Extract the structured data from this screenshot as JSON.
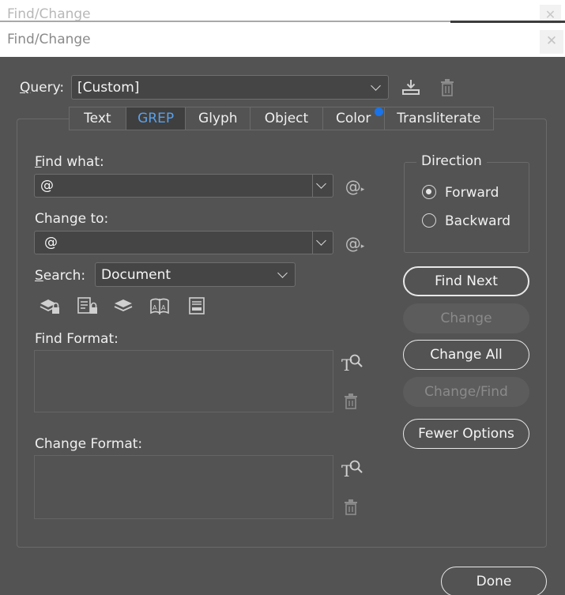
{
  "window": {
    "ghost_title": "Find/Change",
    "ghost_close": "✕",
    "title": "Find/Change",
    "close": "✕"
  },
  "query": {
    "label": "Query:",
    "value": "[Custom]"
  },
  "tabs": [
    {
      "label": "Text",
      "active": false
    },
    {
      "label": "GREP",
      "active": true
    },
    {
      "label": "Glyph",
      "active": false
    },
    {
      "label": "Object",
      "active": false
    },
    {
      "label": "Color",
      "active": false
    },
    {
      "label": "Transliterate",
      "active": false
    }
  ],
  "find_what": {
    "label": "Find what:",
    "value": "@"
  },
  "change_to": {
    "label": "Change to:",
    "value": "@"
  },
  "search": {
    "label": "Search:",
    "value": "Document"
  },
  "find_format": {
    "label": "Find Format:"
  },
  "change_format": {
    "label": "Change Format:"
  },
  "direction": {
    "legend": "Direction",
    "options": [
      {
        "label": "Forward",
        "selected": true
      },
      {
        "label": "Backward",
        "selected": false
      }
    ]
  },
  "buttons": {
    "find_next": "Find Next",
    "change": "Change",
    "change_all": "Change All",
    "change_find": "Change/Find",
    "fewer_options": "Fewer Options",
    "done": "Done"
  },
  "colors": {
    "background": "#535353",
    "active_tab_text": "#5aa0ea",
    "tab_notification_dot": "#1a73e8"
  },
  "icons": {
    "save_query": "save-query-icon",
    "delete_query": "trash-icon",
    "special_chars": "at-sign-icon",
    "include_locked_layers": "locked-layers-icon",
    "include_locked_stories": "locked-stories-icon",
    "include_hidden_layers": "hidden-layers-icon",
    "include_master_pages": "master-pages-icon",
    "include_footnotes": "footnotes-icon",
    "specify_format": "format-search-icon",
    "clear_format": "trash-icon"
  }
}
